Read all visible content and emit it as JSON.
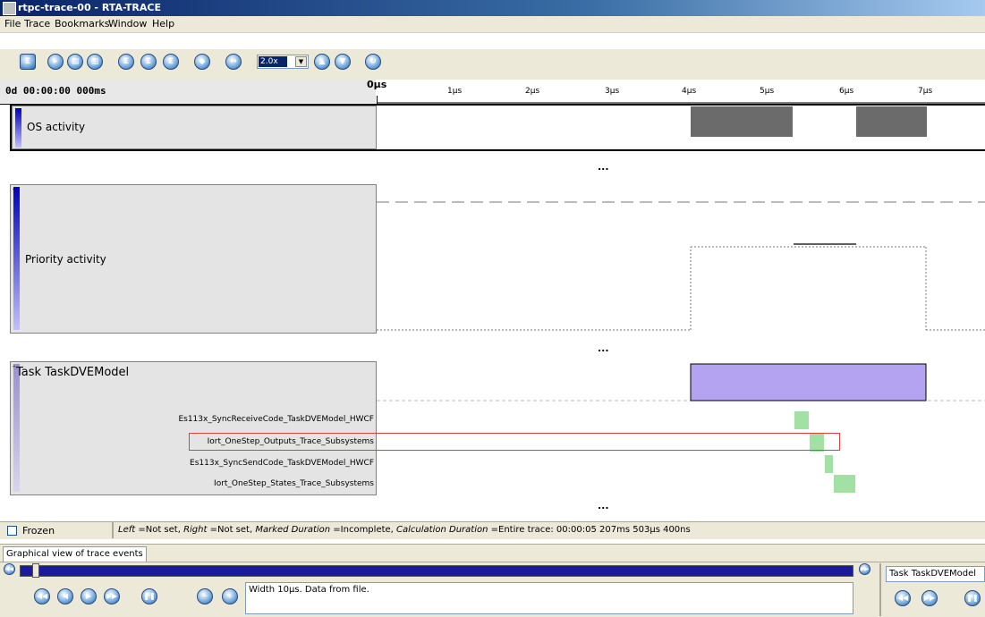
{
  "window": {
    "title": "rtpc-trace-00 - RTA-TRACE"
  },
  "menu": [
    "File",
    "Trace",
    "Bookmarks",
    "Window",
    "Help"
  ],
  "toolbar": {
    "zoom_value": "2.0x"
  },
  "timeline": {
    "current_time": "0d 00:00:00 000ms",
    "ticks": [
      "0µs",
      "1µs",
      "2µs",
      "3µs",
      "4µs",
      "5µs",
      "6µs",
      "7µs"
    ]
  },
  "panels": {
    "os_activity": {
      "label": "OS activity"
    },
    "priority_activity": {
      "label": "Priority activity"
    },
    "task": {
      "label": "Task TaskDVEModel",
      "rows": [
        "Es113x_SyncReceiveCode_TaskDVEModel_HWCF",
        "Iort_OneStep_Outputs_Trace_Subsystems",
        "Es113x_SyncSendCode_TaskDVEModel_HWCF",
        "Iort_OneStep_States_Trace_Subsystems"
      ]
    },
    "ellipsis": "..."
  },
  "status": {
    "frozen_label": "Frozen",
    "text_left_label": "Left",
    "text_left_value": " =Not set, ",
    "text_right_label": "Right",
    "text_right_value": " =Not set, ",
    "text_marked_label": "Marked Duration",
    "text_marked_value": " =Incomplete, ",
    "text_calc_label": "Calculation Duration",
    "text_calc_value": " =Entire trace: 00:00:05 207ms 503µs 400ns"
  },
  "tab": {
    "label": "Graphical view of trace events"
  },
  "bottom": {
    "info": "Width 10µs. Data from file.",
    "task_field": "Task TaskDVEModel"
  },
  "colors": {
    "os_block": "#6b6b6b",
    "task_block": "#b3a3f0",
    "runnable_block": "#a3e0a3",
    "highlight": "#e04040"
  }
}
